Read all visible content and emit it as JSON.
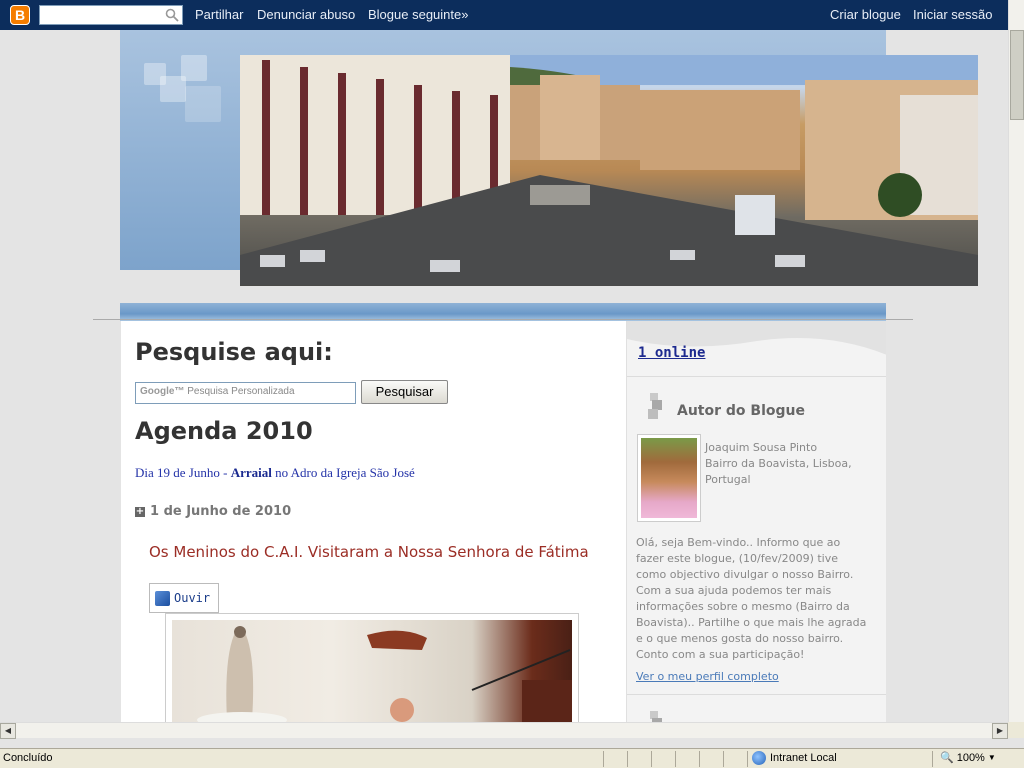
{
  "navbar": {
    "logo": "B",
    "search_value": "",
    "links": [
      "Partilhar",
      "Denunciar abuso",
      "Blogue seguinte»"
    ],
    "right_links": [
      "Criar blogue",
      "Iniciar sessão"
    ]
  },
  "main": {
    "search_heading": "Pesquise aqui:",
    "google_brand": "Google™",
    "google_placeholder": "Pesquisa Personalizada",
    "search_button": "Pesquisar",
    "agenda_heading": "Agenda 2010",
    "agenda_prefix": "Dia 19 de Junho - ",
    "agenda_bold": "Arraial",
    "agenda_suffix": " no Adro da Igreja São José",
    "post_date": "1 de Junho de 2010",
    "post_title": "Os Meninos do C.A.I. Visitaram a Nossa Senhora de Fátima",
    "listen_label": "Ouvir"
  },
  "sidebar": {
    "online": "1 online",
    "author_title": "Autor do Blogue",
    "author_lines": [
      "Joaquim Sousa Pinto",
      "Bairro da Boavista, Lisboa,",
      "Portugal"
    ],
    "about_lines": [
      "Olá, seja Bem-vindo.. Informo que ao",
      "fazer este blogue, (10/fev/2009) tive",
      "como objectivo divulgar o nosso Bairro.",
      "Com a sua ajuda podemos ter mais",
      "informações sobre o mesmo (Bairro da",
      "Boavista).. Partilhe o que mais lhe agrada",
      "e o que menos gosta do nosso bairro.",
      "Conto com a sua participação!"
    ],
    "profile_link": "Ver o meu perfil completo"
  },
  "status": {
    "text": "Concluído",
    "zone": "Intranet Local",
    "zoom": "100%",
    "zoom_caret": "▼"
  },
  "colors": {
    "navbar": "#0c2d5c",
    "post_title": "#9b2d25",
    "agenda_link": "#2433a8"
  },
  "icons": {
    "search": "magnifier-icon",
    "speaker": "speaker-icon",
    "plus": "plus-icon",
    "zone": "globe-icon"
  }
}
